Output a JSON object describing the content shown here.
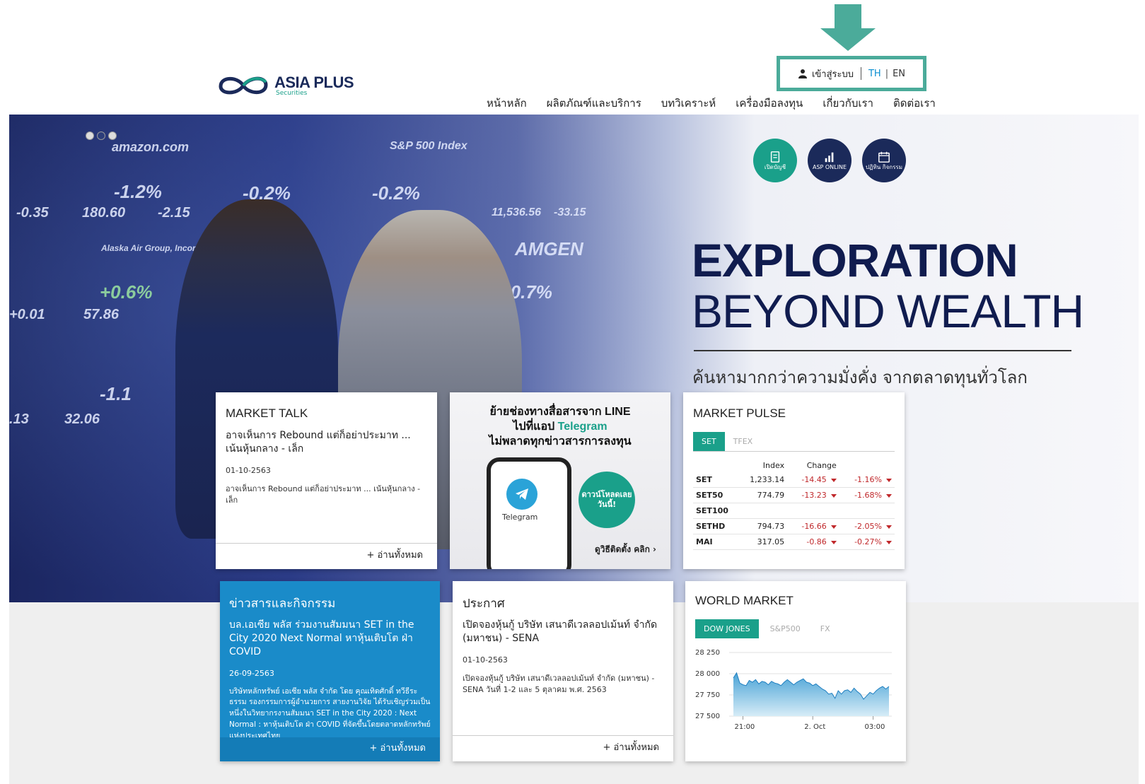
{
  "header": {
    "login_label": "เข้าสู่ระบบ",
    "lang_th": "TH",
    "lang_sep": "|",
    "lang_en": "EN",
    "logo_main": "ASIA PLUS",
    "logo_sub": "Securities",
    "nav": [
      "หน้าหลัก",
      "ผลิตภัณฑ์และบริการ",
      "บทวิเคราะห์",
      "เครื่องมือลงทุน",
      "เกี่ยวกับเรา",
      "ติดต่อเรา"
    ]
  },
  "hero": {
    "title_line1": "EXPLORATION",
    "title_line2": "BEYOND WEALTH",
    "subtitle": "ค้นหามากกว่าความมั่งคั่ง จากตลาดทุนทั่วโลก",
    "shortcuts": [
      {
        "label": "เปิดบัญชี",
        "icon": "document-icon"
      },
      {
        "label": "ASP ONLINE",
        "icon": "bar-chart-icon"
      },
      {
        "label": "ปฏิทิน กิจกรรม",
        "icon": "calendar-icon"
      }
    ],
    "board_tickers": [
      "amazon.com",
      "-1.2%",
      "180.60",
      "-2.15",
      "-0.2%",
      "S&P 500 Index",
      "-0.2%",
      "11,536.56",
      "-33.15",
      "AMGEN",
      "-0.7%",
      "+0.6%",
      "57.86",
      "-1.1",
      "32.06",
      "Alaska Air Group, Incorporated",
      "-0.35",
      "+0.01",
      ".13"
    ]
  },
  "market_talk": {
    "title": "MARKET TALK",
    "headline": "อาจเห็นการ Rebound แต่ก็อย่าประมาท ... เน้นหุ้นกลาง - เล็ก",
    "date": "01-10-2563",
    "excerpt": "อาจเห็นการ Rebound แต่ก็อย่าประมาท ... เน้นหุ้นกลาง - เล็ก",
    "read_all": "+ อ่านทั้งหมด"
  },
  "telegram_promo": {
    "line1": "ย้ายช่องทางสื่อสารจาก LINE",
    "line2_prefix": "ไปที่แอป ",
    "line2_highlight": "Telegram",
    "line3": "ไม่พลาดทุกข่าวสารการลงทุน",
    "app_label": "Telegram",
    "bubble": "ดาวน์โหลดเลย วันนี้!",
    "howto": "ดูวิธีติดตั้ง คลิก ›"
  },
  "market_pulse": {
    "title": "MARKET PULSE",
    "tabs": [
      "SET",
      "TFEX"
    ],
    "columns": [
      "Index",
      "Change"
    ],
    "rows": [
      {
        "name": "SET",
        "index": "1,233.14",
        "change": "-14.45",
        "pct": "-1.16%"
      },
      {
        "name": "SET50",
        "index": "774.79",
        "change": "-13.23",
        "pct": "-1.68%"
      },
      {
        "name": "SET100",
        "index": "",
        "change": "",
        "pct": ""
      },
      {
        "name": "SETHD",
        "index": "794.73",
        "change": "-16.66",
        "pct": "-2.05%"
      },
      {
        "name": "MAI",
        "index": "317.05",
        "change": "-0.86",
        "pct": "-0.27%"
      }
    ]
  },
  "news": {
    "title": "ข่าวสารและกิจกรรม",
    "headline": "บล.เอเซีย พลัส ร่วมงานสัมมนา SET in the City 2020 Next Normal หาหุ้นเติบโต ฝ่า COVID",
    "date": "26-09-2563",
    "excerpt": "บริษัทหลักทรัพย์ เอเซีย พลัส จำกัด โดย คุณเทิดศักดิ์ ทวีธีระธรรม รองกรรมการผู้อำนวยการ สายงานวิจัย ได้รับเชิญร่วมเป็นหนึ่งในวิทยากรงานสัมมนา SET in the City 2020 : Next Normal : หาหุ้นเติบโต ฝ่า COVID ที่จัดขึ้นโดยตลาดหลักทรัพย์แห่งประเทศไทย",
    "read_all": "+ อ่านทั้งหมด"
  },
  "announcement": {
    "title": "ประกาศ",
    "headline": "เปิดจองหุ้นกู้ บริษัท เสนาดีเวลลอปเม้นท์ จำกัด (มหาชน) - SENA",
    "date": "01-10-2563",
    "excerpt": "เปิดจองหุ้นกู้ บริษัท เสนาดีเวลลอปเม้นท์ จำกัด (มหาชน) - SENA วันที่ 1-2 และ 5 ตุลาคม พ.ศ. 2563",
    "read_all": "+ อ่านทั้งหมด"
  },
  "world_market": {
    "title": "WORLD MARKET",
    "tabs": [
      "DOW JONES",
      "S&P500",
      "FX"
    ]
  },
  "colors": {
    "teal": "#1aa08a",
    "navy": "#1b2a5a",
    "news_blue": "#1a8bc9",
    "negative": "#c0282b",
    "annotation": "#4bab9a"
  },
  "chart_data": {
    "type": "area",
    "title": "",
    "xlabel": "",
    "ylabel": "",
    "x_ticks": [
      "21:00",
      "2. Oct",
      "03:00"
    ],
    "y_ticks": [
      27500,
      27750,
      28000,
      28250
    ],
    "y_tick_labels": [
      "27 500",
      "27 750",
      "28 000",
      "28 250"
    ],
    "ylim": [
      27500,
      28250
    ],
    "grid": true,
    "series": [
      {
        "values": [
          27950,
          28010,
          27890,
          27870,
          27860,
          27920,
          27900,
          27930,
          27880,
          27910,
          27900,
          27870,
          27910,
          27890,
          27880,
          27860,
          27900,
          27930,
          27900,
          27870,
          27900,
          27920,
          27940,
          27900,
          27890,
          27860,
          27880,
          27850,
          27820,
          27800,
          27760,
          27770,
          27710,
          27800,
          27760,
          27800,
          27810,
          27780,
          27830,
          27790,
          27760,
          27700,
          27740,
          27780,
          27760,
          27800,
          27830,
          27850,
          27820,
          27850
        ]
      }
    ]
  }
}
